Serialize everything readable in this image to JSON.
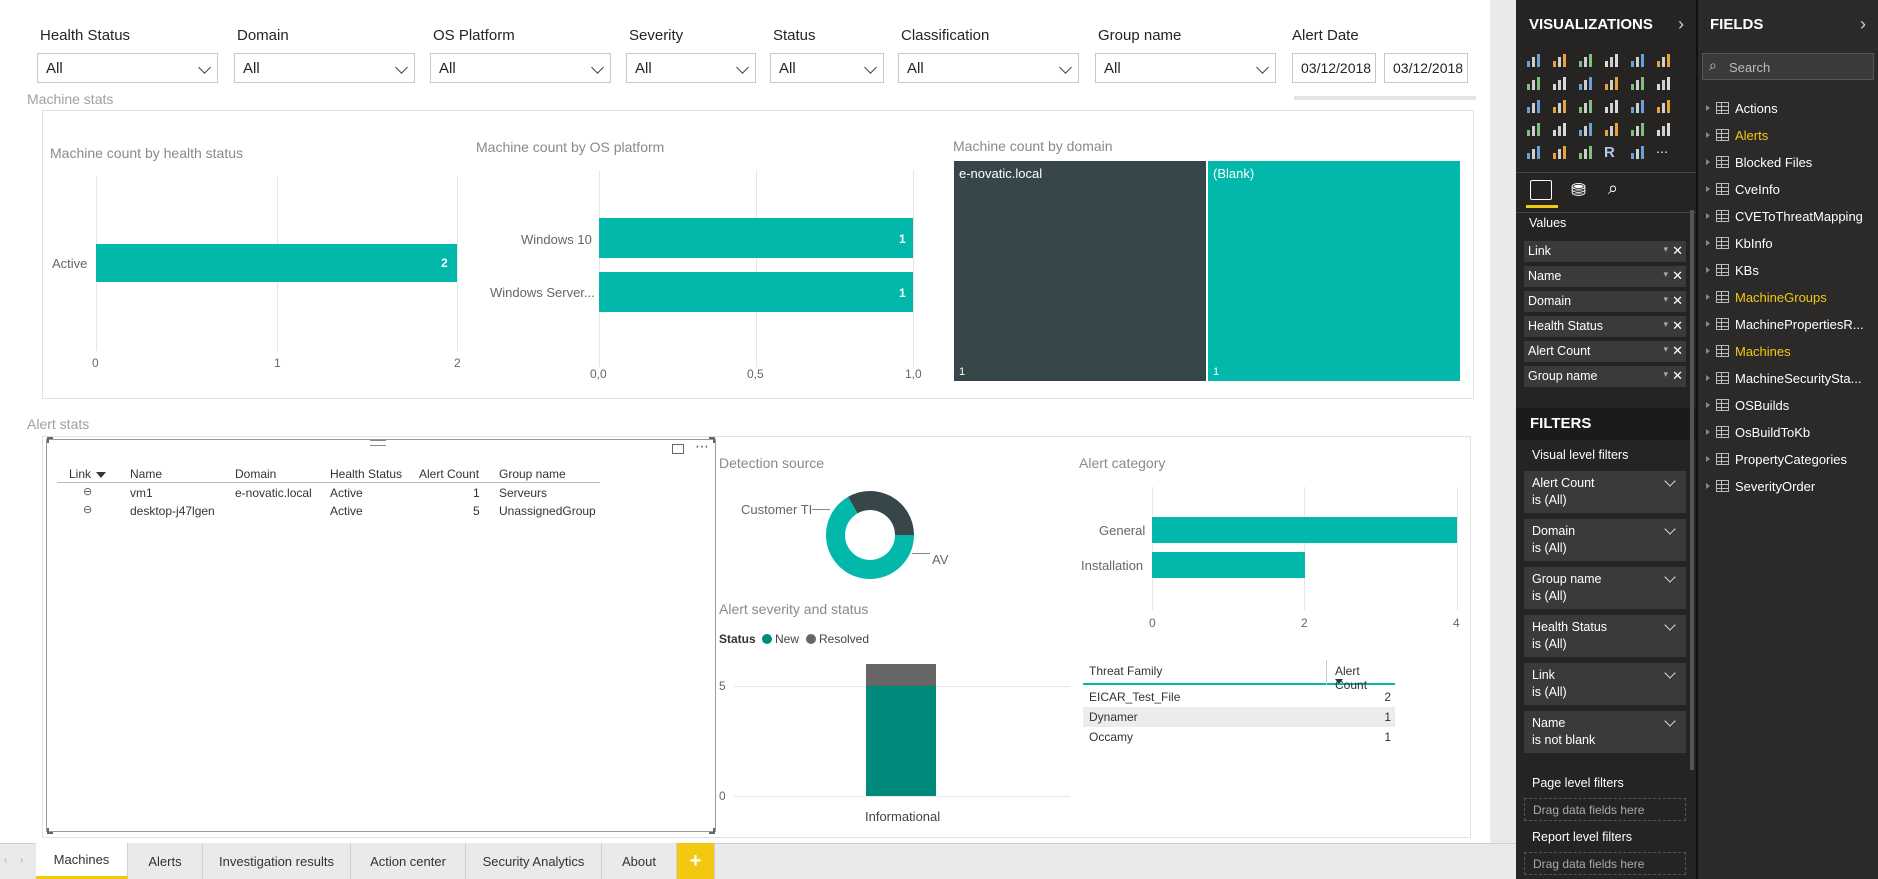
{
  "slicers": [
    {
      "label": "Health Status",
      "value": "All"
    },
    {
      "label": "Domain",
      "value": "All"
    },
    {
      "label": "OS Platform",
      "value": "All"
    },
    {
      "label": "Severity",
      "value": "All"
    },
    {
      "label": "Status",
      "value": "All"
    },
    {
      "label": "Classification",
      "value": "All"
    },
    {
      "label": "Group name",
      "value": "All"
    }
  ],
  "alert_date": {
    "label": "Alert Date",
    "from": "03/12/2018",
    "to": "03/12/2018"
  },
  "sections": {
    "machine_stats": "Machine stats",
    "alert_stats": "Alert stats"
  },
  "health_chart": {
    "title": "Machine count by health status",
    "categories": [
      "Active"
    ],
    "values": [
      2
    ],
    "value_labels": [
      "2"
    ],
    "ticks": [
      "0",
      "1",
      "2"
    ]
  },
  "os_chart": {
    "title": "Machine count by OS platform",
    "categories": [
      "Windows 10",
      "Windows Server..."
    ],
    "values": [
      1,
      1
    ],
    "value_labels": [
      "1",
      "1"
    ],
    "ticks": [
      "0,0",
      "0,5",
      "1,0"
    ]
  },
  "domain_treemap": {
    "title": "Machine count by domain",
    "tiles": [
      {
        "label": "e-novatic.local",
        "count": "1",
        "color": "#374649"
      },
      {
        "label": "(Blank)",
        "count": "1",
        "color": "#01b8aa"
      }
    ]
  },
  "machines_table": {
    "columns": [
      "Link",
      "Name",
      "Domain",
      "Health Status",
      "Alert Count",
      "Group name"
    ],
    "rows": [
      {
        "name": "vm1",
        "domain": "e-novatic.local",
        "health": "Active",
        "count": "1",
        "group": "Serveurs"
      },
      {
        "name": "desktop-j47lgen",
        "domain": "",
        "health": "Active",
        "count": "5",
        "group": "UnassignedGroup"
      }
    ]
  },
  "detection_source": {
    "title": "Detection source",
    "slices": [
      {
        "label": "Customer TI",
        "value": 1,
        "color": "#374649"
      },
      {
        "label": "AV",
        "value": 2,
        "color": "#01b8aa"
      }
    ]
  },
  "alert_category": {
    "title": "Alert category",
    "categories": [
      "General",
      "Installation"
    ],
    "values": [
      4,
      2
    ],
    "ticks": [
      "0",
      "2",
      "4"
    ]
  },
  "severity_status": {
    "title": "Alert severity and status",
    "legend_title": "Status",
    "series": [
      {
        "name": "New",
        "color": "#01897c",
        "value": 5
      },
      {
        "name": "Resolved",
        "color": "#666666",
        "value": 1
      }
    ],
    "category": "Informational",
    "ticks": [
      "5",
      "0"
    ]
  },
  "threat_table": {
    "columns": [
      "Threat Family",
      "Alert Count"
    ],
    "rows": [
      {
        "family": "EICAR_Test_File",
        "count": "2"
      },
      {
        "family": "Dynamer",
        "count": "1"
      },
      {
        "family": "Occamy",
        "count": "1"
      }
    ]
  },
  "viz_pane": {
    "title": "VISUALIZATIONS",
    "values_label": "Values",
    "wells": [
      "Link",
      "Name",
      "Domain",
      "Health Status",
      "Alert Count",
      "Group name"
    ],
    "filters_title": "FILTERS",
    "visual_filters_label": "Visual level filters",
    "filters": [
      {
        "name": "Alert Count",
        "state": "is (All)"
      },
      {
        "name": "Domain",
        "state": "is (All)"
      },
      {
        "name": "Group name",
        "state": "is (All)"
      },
      {
        "name": "Health Status",
        "state": "is (All)"
      },
      {
        "name": "Link",
        "state": "is (All)"
      },
      {
        "name": "Name",
        "state": "is not blank"
      }
    ],
    "page_filters_label": "Page level filters",
    "drag_here": "Drag data fields here",
    "report_filters_label": "Report level filters"
  },
  "fields_pane": {
    "title": "FIELDS",
    "search_placeholder": "Search",
    "tables": [
      {
        "name": "Actions",
        "highlight": false
      },
      {
        "name": "Alerts",
        "highlight": true
      },
      {
        "name": "Blocked Files",
        "highlight": false
      },
      {
        "name": "CveInfo",
        "highlight": false
      },
      {
        "name": "CVEToThreatMapping",
        "highlight": false
      },
      {
        "name": "KbInfo",
        "highlight": false
      },
      {
        "name": "KBs",
        "highlight": false
      },
      {
        "name": "MachineGroups",
        "highlight": true
      },
      {
        "name": "MachinePropertiesR...",
        "highlight": false
      },
      {
        "name": "Machines",
        "highlight": true
      },
      {
        "name": "MachineSecuritySta...",
        "highlight": false
      },
      {
        "name": "OSBuilds",
        "highlight": false
      },
      {
        "name": "OsBuildToKb",
        "highlight": false
      },
      {
        "name": "PropertyCategories",
        "highlight": false
      },
      {
        "name": "SeverityOrder",
        "highlight": false
      }
    ]
  },
  "tabs": [
    "Machines",
    "Alerts",
    "Investigation results",
    "Action center",
    "Security Analytics",
    "About"
  ],
  "add_tab": "+",
  "colors": {
    "teal": "#01b8aa",
    "dark": "#374649",
    "accent": "#f2c811"
  }
}
